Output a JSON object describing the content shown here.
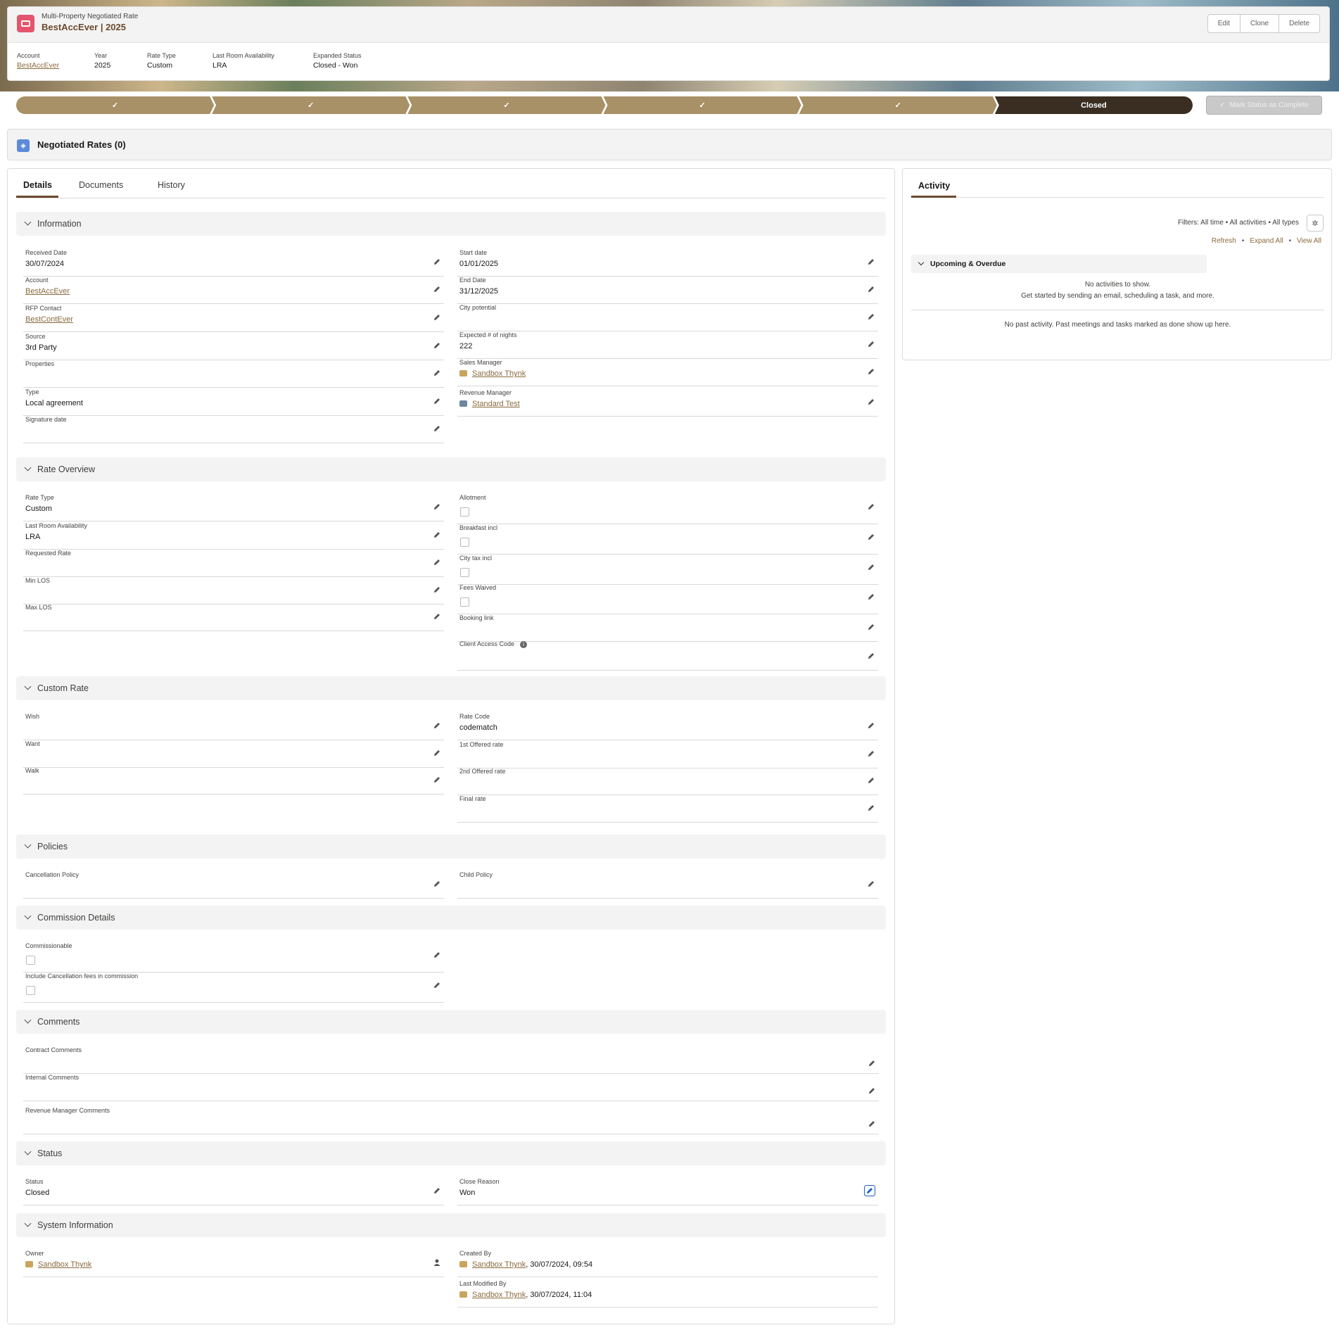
{
  "header": {
    "object_label": "Multi-Property Negotiated Rate",
    "title": "BestAccEver | 2025",
    "buttons": {
      "edit": "Edit",
      "clone": "Clone",
      "delete": "Delete"
    },
    "fields": [
      {
        "label": "Account",
        "value": "BestAccEver"
      },
      {
        "label": "Year",
        "value": "2025"
      },
      {
        "label": "Rate Type",
        "value": "Custom"
      },
      {
        "label": "Last Room Availability",
        "value": "LRA"
      },
      {
        "label": "Expanded Status",
        "value": "Closed - Won"
      }
    ]
  },
  "path": {
    "steps": [
      "",
      "",
      "",
      "",
      ""
    ],
    "current": "Closed",
    "mark_button": "Mark Status as Complete"
  },
  "related": {
    "title": "Negotiated Rates (0)"
  },
  "tabs": {
    "details": "Details",
    "documents": "Documents",
    "history": "History"
  },
  "sections": {
    "information": {
      "title": "Information",
      "left": [
        {
          "label": "Received Date",
          "value": "30/07/2024"
        },
        {
          "label": "Account",
          "value": "BestAccEver"
        },
        {
          "label": "RFP Contact",
          "value": "BestContEver"
        },
        {
          "label": "Source",
          "value": "3rd Party"
        },
        {
          "label": "Properties",
          "value": ""
        },
        {
          "label": "Type",
          "value": "Local agreement"
        },
        {
          "label": "Signature date",
          "value": ""
        }
      ],
      "right": [
        {
          "label": "Start date",
          "value": "01/01/2025"
        },
        {
          "label": "End Date",
          "value": "31/12/2025"
        },
        {
          "label": "City potential",
          "value": ""
        },
        {
          "label": "Expected # of nights",
          "value": "222"
        },
        {
          "label": "Sales Manager",
          "value": "Sandbox Thynk"
        },
        {
          "label": "Revenue Manager",
          "value": "Standard Test"
        }
      ]
    },
    "rate_overview": {
      "title": "Rate Overview",
      "left": [
        {
          "label": "Rate Type",
          "value": "Custom"
        },
        {
          "label": "Last Room Availability",
          "value": "LRA"
        },
        {
          "label": "Requested Rate",
          "value": ""
        },
        {
          "label": "Min LOS",
          "value": ""
        },
        {
          "label": "Max LOS",
          "value": ""
        }
      ],
      "right": [
        {
          "label": "Allotment",
          "checked": false
        },
        {
          "label": "Breakfast incl",
          "checked": false
        },
        {
          "label": "City tax incl",
          "checked": false
        },
        {
          "label": "Fees Waived",
          "checked": false
        },
        {
          "label": "Booking link",
          "value": ""
        },
        {
          "label": "Client Access Code",
          "value": ""
        }
      ]
    },
    "custom_rate": {
      "title": "Custom Rate",
      "left": [
        {
          "label": "Wish",
          "value": ""
        },
        {
          "label": "Want",
          "value": ""
        },
        {
          "label": "Walk",
          "value": ""
        }
      ],
      "right": [
        {
          "label": "Rate Code",
          "value": "codematch"
        },
        {
          "label": "1st Offered rate",
          "value": ""
        },
        {
          "label": "2nd Offered rate",
          "value": ""
        },
        {
          "label": "Final rate",
          "value": ""
        }
      ]
    },
    "policies": {
      "title": "Policies",
      "left": [
        {
          "label": "Cancellation Policy",
          "value": ""
        }
      ],
      "right": [
        {
          "label": "Child Policy",
          "value": ""
        }
      ]
    },
    "commission": {
      "title": "Commission Details",
      "left": [
        {
          "label": "Commissionable",
          "checked": false
        },
        {
          "label": "Include Cancellation fees in commission",
          "checked": false
        }
      ]
    },
    "comments": {
      "title": "Comments",
      "full": [
        {
          "label": "Contract Comments",
          "value": ""
        },
        {
          "label": "Internal Comments",
          "value": ""
        },
        {
          "label": "Revenue Manager Comments",
          "value": ""
        }
      ]
    },
    "status": {
      "title": "Status",
      "left": [
        {
          "label": "Status",
          "value": "Closed"
        }
      ],
      "right": [
        {
          "label": "Close Reason",
          "value": "Won"
        }
      ]
    },
    "system": {
      "title": "System Information",
      "owner_label": "Owner",
      "owner": "Sandbox Thynk",
      "created_label": "Created By",
      "created_user": "Sandbox Thynk",
      "created_date": ", 30/07/2024, 09:54",
      "modified_label": "Last Modified By",
      "modified_user": "Sandbox Thynk",
      "modified_date": ", 30/07/2024, 11:04"
    }
  },
  "activity": {
    "title": "Activity",
    "filters": "Filters: All time • All activities • All types",
    "links": {
      "refresh": "Refresh",
      "expand_all": "Expand All",
      "view_all": "View All"
    },
    "upcoming_title": "Upcoming & Overdue",
    "no_activities": "No activities to show.",
    "get_started": "Get started by sending an email, scheduling a task, and more.",
    "no_past": "No past activity. Past meetings and tasks marked as done show up here."
  },
  "colors": {
    "brand": "#6c4a2e",
    "path_complete": "#a89067",
    "path_current": "#3a2e22",
    "object_icon": "#e3566d"
  }
}
